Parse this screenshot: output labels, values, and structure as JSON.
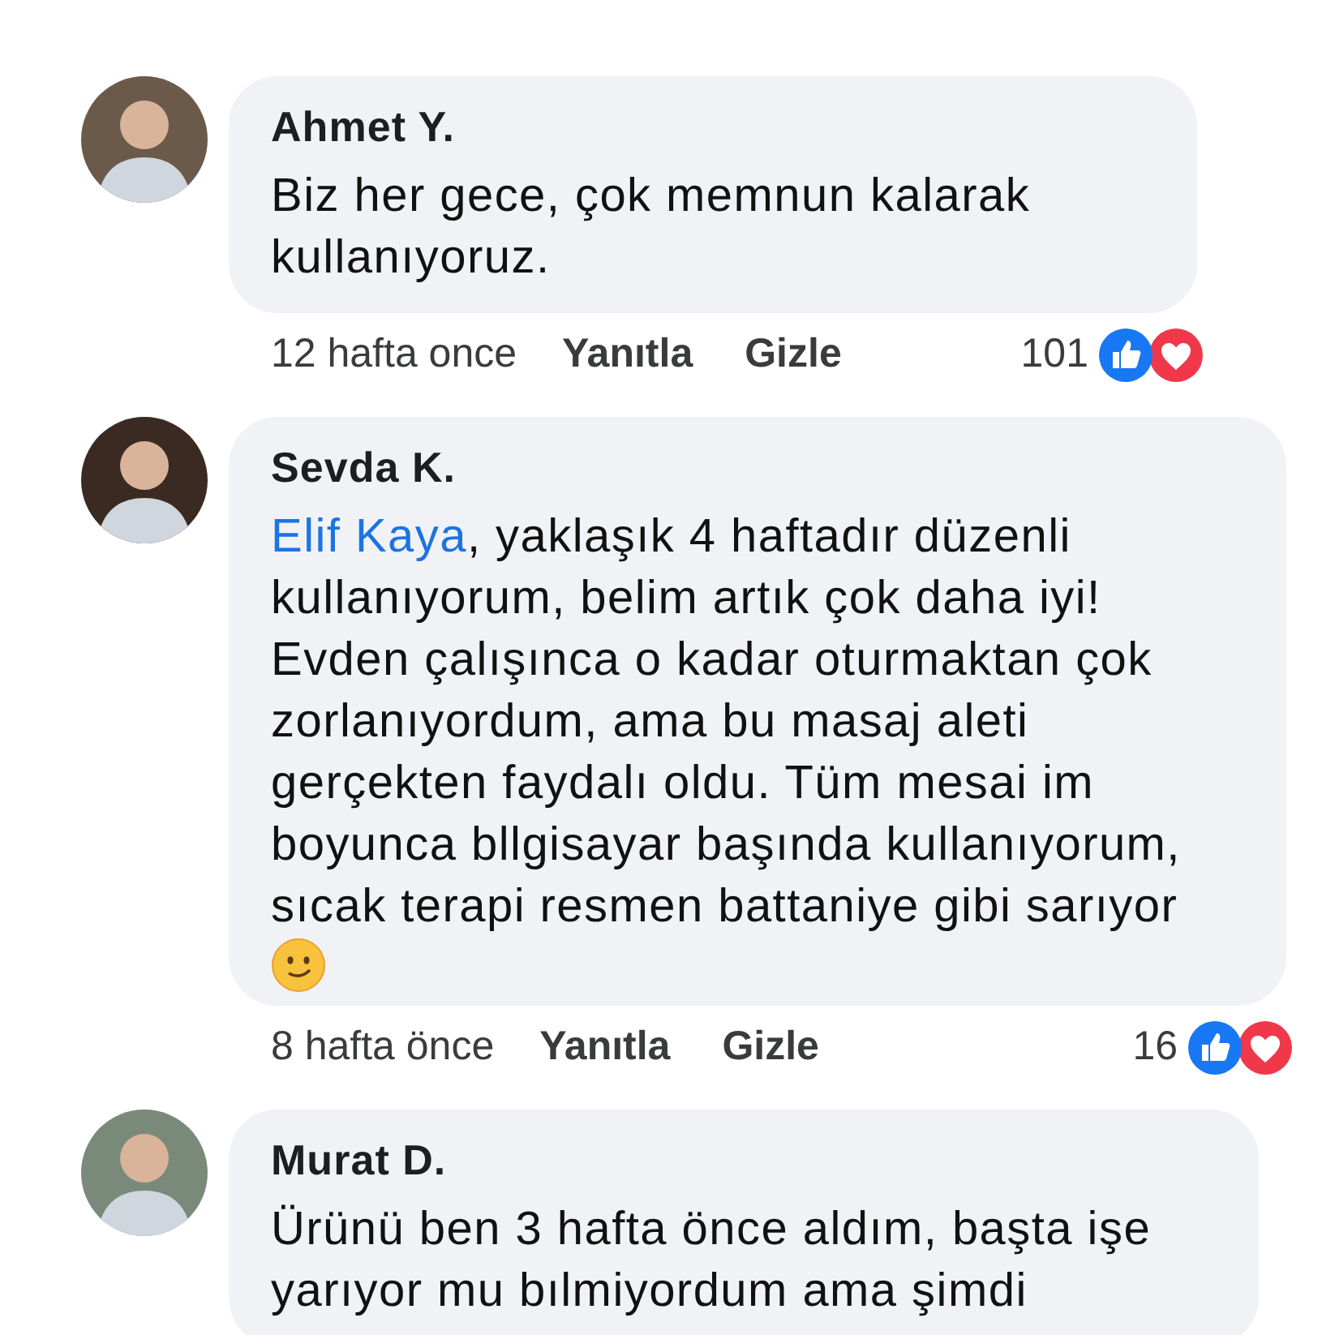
{
  "comments": [
    {
      "author": "Ahmet Y.",
      "text": "Biz her gece, çok memnun kalarak kullanıyoruz.",
      "trailing_emoji": false,
      "time": "12 hafta once",
      "actions": [
        "Yanıtla",
        "Gizle"
      ],
      "reaction_count": "101"
    },
    {
      "author": "Sevda K.",
      "mention": "Elif Kaya",
      "text": ", yaklaşık 4 haftadır düzenli kullanıyorum, belim artık çok daha iyi! Evden çalışınca o kadar oturmaktan çok zorlanıyordum, ama bu masaj aleti gerçekten faydalı oldu. Tüm mesai im boyunca bllgisayar başında kullanıyorum, sıcak terapi resmen battaniye gibi sarıyor",
      "trailing_emoji": true,
      "time": "8 hafta önce",
      "actions": [
        "Yanıtla",
        "Gizle"
      ],
      "reaction_count": "16"
    },
    {
      "author": "Murat D.",
      "text": "Ürünü ben 3 hafta önce aldım, başta işe yarıyor mu bılmiyordum ama şimdi",
      "trailing_emoji": false
    }
  ]
}
